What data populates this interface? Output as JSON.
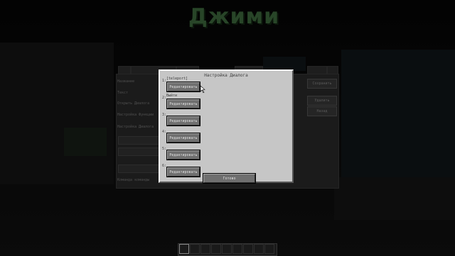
{
  "npc_name": "Джими",
  "dialog": {
    "title": "Настройка Диалога",
    "options": [
      {
        "num": "1:",
        "label": "[teleport]",
        "button": "Редактировать"
      },
      {
        "num": "2:",
        "label": "Выйти",
        "button": "Редактировать"
      },
      {
        "num": "3:",
        "label": "",
        "button": "Редактировать"
      },
      {
        "num": "4:",
        "label": "",
        "button": "Редактировать"
      },
      {
        "num": "5:",
        "label": "",
        "button": "Редактировать"
      },
      {
        "num": "6:",
        "label": "",
        "button": "Редактировать"
      }
    ],
    "done_label": "Готово"
  },
  "background_editor": {
    "left_labels": [
      "Название",
      "Текст",
      "Открыть Диалога",
      "Настройка Функции",
      "Настройка Диалога",
      "Команда команды"
    ],
    "right_buttons": [
      "Сохранить",
      "Удалить",
      "Назад"
    ]
  },
  "hotbar": {
    "slots": 9,
    "selected": 0
  },
  "colors": {
    "panel": "#c6c6c6",
    "button": "#6f6f6f",
    "name": "#3e6b3e"
  }
}
